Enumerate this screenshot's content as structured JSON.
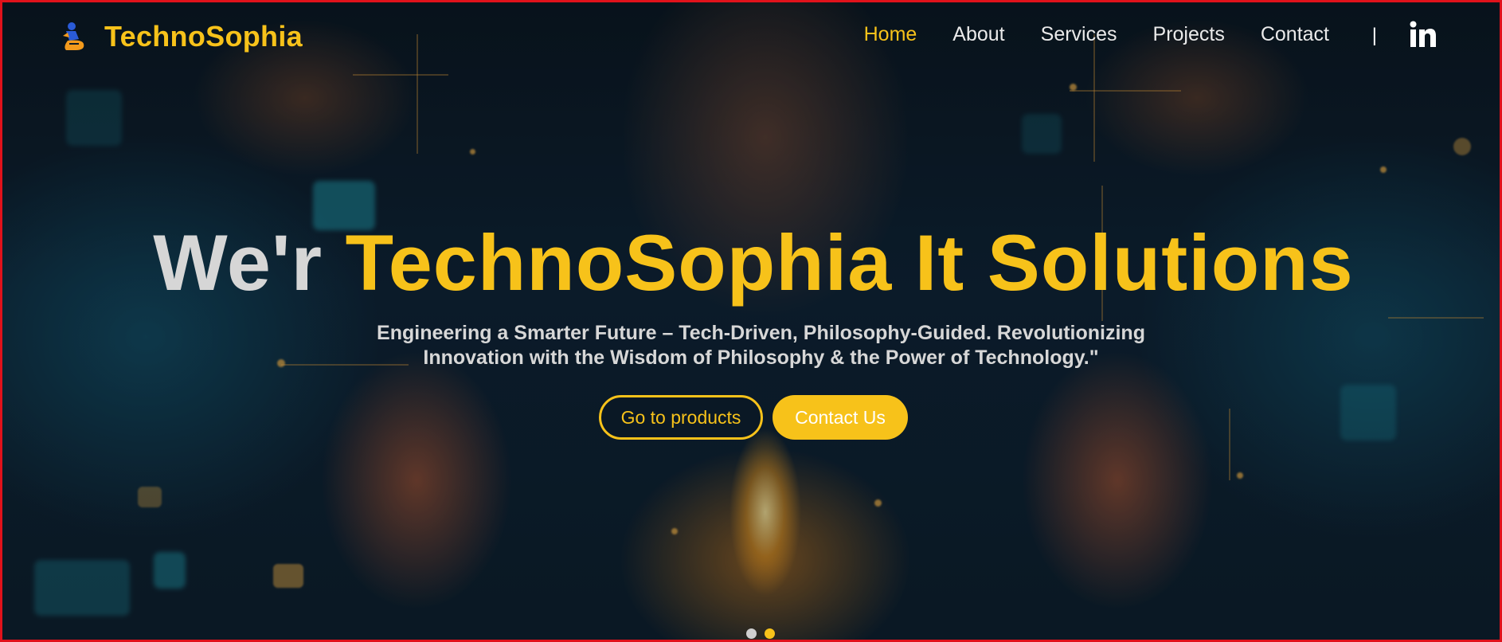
{
  "brand": {
    "name": "TechnoSophia",
    "logo_icon": "robot-logo-icon"
  },
  "nav": {
    "items": [
      {
        "label": "Home",
        "active": true
      },
      {
        "label": "About",
        "active": false
      },
      {
        "label": "Services",
        "active": false
      },
      {
        "label": "Projects",
        "active": false
      },
      {
        "label": "Contact",
        "active": false
      }
    ],
    "separator": "|",
    "social_icon": "linkedin-icon"
  },
  "hero": {
    "headline_prefix": "We'r",
    "headline_brand": "TechnoSophia It Solutions",
    "tagline_line1": "Engineering a Smarter Future – Tech-Driven, Philosophy-Guided. Revolutionizing",
    "tagline_line2": "Innovation with the Wisdom of Philosophy & the Power of Technology.\"",
    "primary_button": "Go to products",
    "secondary_button": "Contact Us"
  },
  "carousel": {
    "slides": 2,
    "active_index": 1
  },
  "colors": {
    "accent": "#f7c21a",
    "border": "#e0121b",
    "dot_inactive": "#cfcfcf"
  }
}
